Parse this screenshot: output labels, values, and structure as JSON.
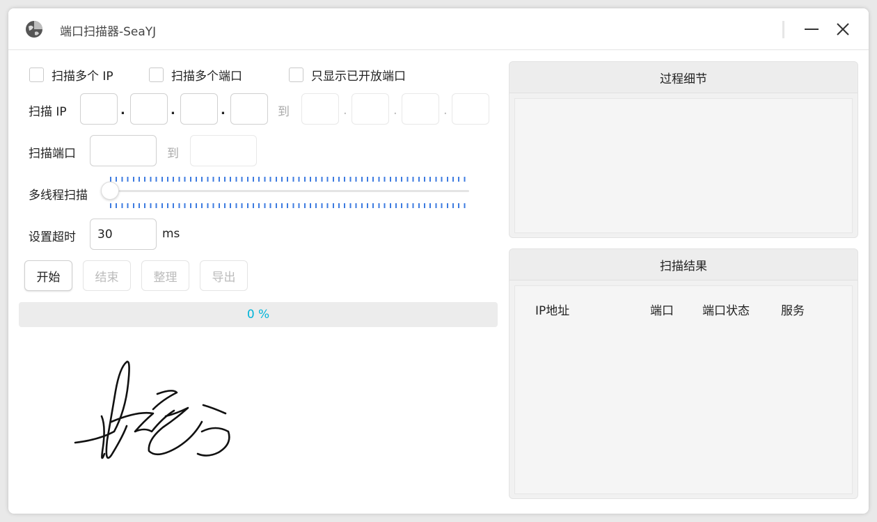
{
  "window": {
    "title": "端口扫描器-SeaYJ"
  },
  "options": {
    "multi_ip": "扫描多个 IP",
    "multi_port": "扫描多个端口",
    "only_open": "只显示已开放端口"
  },
  "scan_ip": {
    "label": "扫描 IP",
    "to": "到",
    "from_octets": [
      "",
      "",
      "",
      ""
    ],
    "to_octets": [
      "",
      "",
      "",
      ""
    ]
  },
  "scan_port": {
    "label": "扫描端口",
    "to": "到",
    "from": "",
    "end": ""
  },
  "threads": {
    "label": "多线程扫描",
    "value": 0
  },
  "timeout": {
    "label": "设置超时",
    "value": "30",
    "unit": "ms"
  },
  "buttons": {
    "start": "开始",
    "stop": "结束",
    "arrange": "整理",
    "export": "导出"
  },
  "progress": {
    "text": "0 %",
    "value": 0
  },
  "details_panel": {
    "title": "过程细节"
  },
  "results_panel": {
    "title": "扫描结果",
    "columns": [
      "IP地址",
      "端口",
      "端口状态",
      "服务"
    ]
  },
  "colors": {
    "accent": "#00b4d8",
    "ticks": "#3d7be0"
  }
}
